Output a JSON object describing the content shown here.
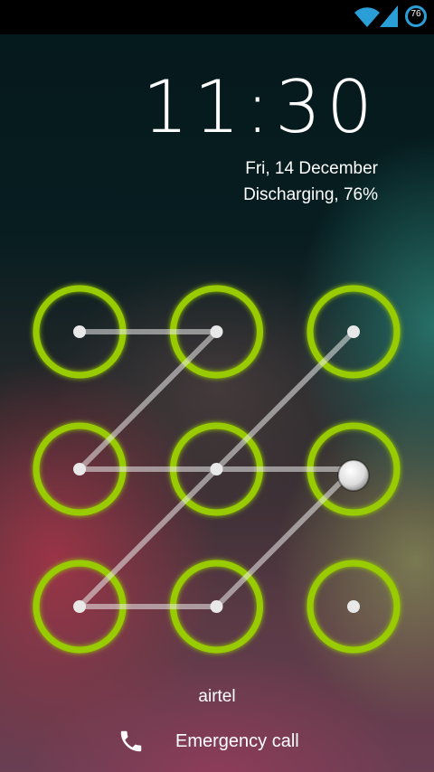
{
  "status_bar": {
    "icons": [
      "wifi-icon",
      "signal-icon",
      "battery-circle-icon"
    ],
    "battery_level": "76"
  },
  "lock_screen": {
    "time": "11:30",
    "date": "Fri, 14 December",
    "battery_status": "Discharging, 76%",
    "carrier": "airtel",
    "emergency_call_label": "Emergency call",
    "emergency_icon": "phone-icon"
  },
  "pattern": {
    "grid_size": 3,
    "sequence": [
      1,
      2,
      4,
      5,
      6,
      8,
      7,
      5,
      3
    ],
    "accent_color": "#99cc00"
  }
}
